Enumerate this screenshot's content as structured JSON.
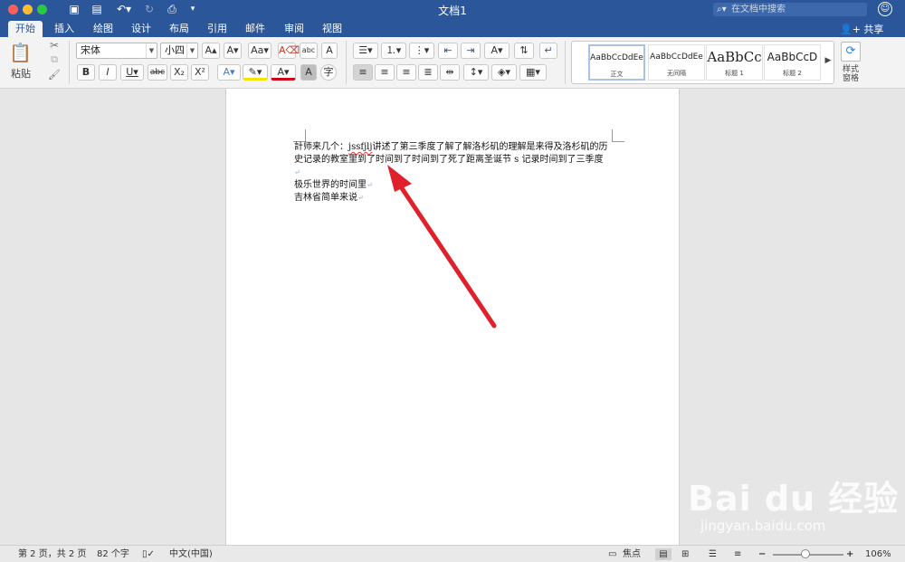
{
  "window": {
    "title": "文档1",
    "search_placeholder": "在文档中搜索",
    "share_label": "共享"
  },
  "tabs": [
    "开始",
    "插入",
    "绘图",
    "设计",
    "布局",
    "引用",
    "邮件",
    "审阅",
    "视图"
  ],
  "ribbon": {
    "paste_label": "粘贴",
    "font_name": "宋体",
    "font_size": "小四",
    "styles": [
      {
        "sample": "AaBbCcDdEe",
        "name": "正文"
      },
      {
        "sample": "AaBbCcDdEe",
        "name": "无间隔"
      },
      {
        "sample": "AaBbCc",
        "name": "标题 1"
      },
      {
        "sample": "AaBbCcD",
        "name": "标题 2"
      }
    ],
    "styles_pane_label": "样式\n窗格"
  },
  "document": {
    "para1_pre": "計师来几个：",
    "para1_err": "jssfjlj",
    "para1_post": "讲述了第三季度了解了解洛杉矶的理解是来得及洛杉矶的历史记录的教室里到了时间到了时间到了死了距离圣诞节 s 记录时间到了三季度",
    "para2": "极乐世界的时间里",
    "para3": "吉林省简单来说"
  },
  "status": {
    "page": "第 2 页，共 2 页",
    "words": "82 个字",
    "language": "中文(中国)",
    "focus": "焦点",
    "zoom": "106%"
  },
  "watermark": {
    "brand": "Bai du 经验",
    "url": "jingyan.baidu.com"
  },
  "colors": {
    "accent": "#2b579a",
    "annotation_arrow": "#e0202a"
  }
}
